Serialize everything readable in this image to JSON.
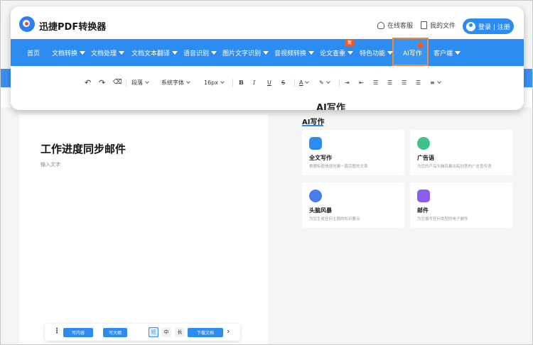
{
  "app": {
    "name": "迅捷PDF转换器"
  },
  "header": {
    "service": "在线客服",
    "my_files": "我的文件",
    "login": "登录 | 注册"
  },
  "nav": {
    "items": [
      {
        "label": "首页",
        "has_caret": false
      },
      {
        "label": "文档转换",
        "has_caret": true
      },
      {
        "label": "文档处理",
        "has_caret": true
      },
      {
        "label": "文档文本翻译",
        "has_caret": true
      },
      {
        "label": "语音识别",
        "has_caret": true
      },
      {
        "label": "图片文字识别",
        "has_caret": true
      },
      {
        "label": "音视频转换",
        "has_caret": true
      },
      {
        "label": "论文查重",
        "has_caret": true
      },
      {
        "label": "特色功能",
        "has_caret": true
      },
      {
        "label": "AI写作",
        "has_caret": false,
        "active": true
      },
      {
        "label": "客户端",
        "has_caret": true
      }
    ],
    "new_badge": "新"
  },
  "editor_toolbar": {
    "paragraph": "段落",
    "font": "系统字体",
    "size": "16px",
    "bold": "B",
    "italic": "I",
    "underline": "U",
    "strike": "S",
    "font_color": "A"
  },
  "card_overflow_text": "AI写作",
  "document": {
    "title": "工作进度同步邮件",
    "placeholder": "输入文字"
  },
  "bottom_bar": {
    "write_content": "写内容",
    "write_outline": "写大纲",
    "len_short": "短",
    "len_medium": "中",
    "len_long": "长",
    "download": "下载文档",
    "active_length": "短"
  },
  "right_panel": {
    "title": "AI写作",
    "features": [
      {
        "name": "全文写作",
        "desc": "根据标题快速创建一篇完整的文章",
        "icon": "fulltext-icon",
        "color": "#2d8cf0"
      },
      {
        "name": "广告语",
        "desc": "为您的产品头脑风暴出有创意的广告宣传语",
        "icon": "ad-icon",
        "color": "#3cc28a"
      },
      {
        "name": "头脑风暴",
        "desc": "为您生成任何主题的知识要点",
        "icon": "brainstorm-icon",
        "color": "#4a7cf0"
      },
      {
        "name": "邮件",
        "desc": "为您撰写任何类型的电子邮件",
        "icon": "mail-icon",
        "color": "#8a5cf0"
      }
    ]
  },
  "colors": {
    "brand": "#2d8cf0",
    "highlight_border": "#f08a3c",
    "badge": "#f05a28"
  }
}
